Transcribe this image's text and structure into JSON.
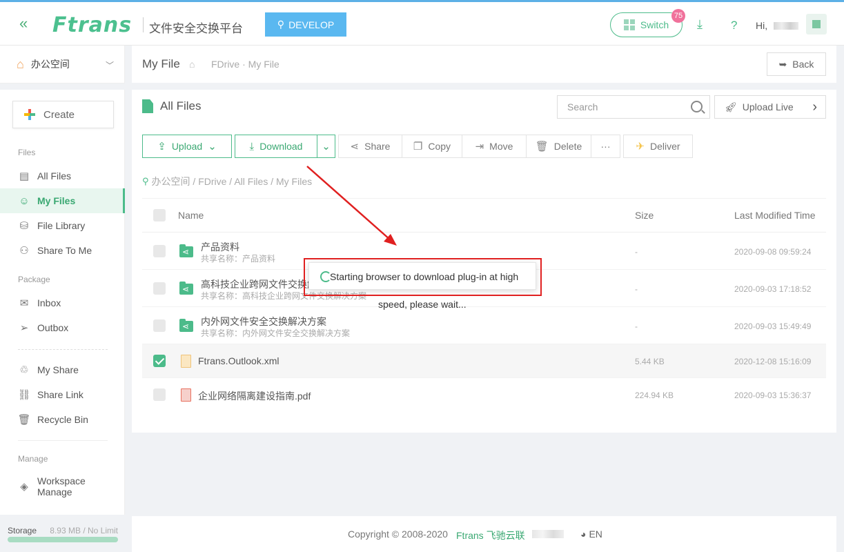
{
  "header": {
    "logo": "Ftrans",
    "subtitle": "文件安全交换平台",
    "env_label": "DEVELOP",
    "switch_label": "Switch",
    "switch_badge": "75",
    "help": "?",
    "greeting": "Hi,"
  },
  "sidebar": {
    "workspace": "办公空间",
    "create_label": "Create",
    "sections": {
      "files": "Files",
      "package": "Package",
      "manage": "Manage"
    },
    "items": {
      "all_files": "All Files",
      "my_files": "My Files",
      "file_library": "File Library",
      "share_to_me": "Share To Me",
      "inbox": "Inbox",
      "outbox": "Outbox",
      "my_share": "My Share",
      "share_link": "Share Link",
      "recycle_bin": "Recycle Bin",
      "workspace_manage_1": "Workspace",
      "workspace_manage_2": "Manage"
    },
    "storage_label": "Storage",
    "storage_value": "8.93 MB / No Limit"
  },
  "breadcrumb": {
    "title": "My File",
    "path": "FDrive · My File",
    "back": "Back"
  },
  "main": {
    "title": "All Files",
    "search_placeholder": "Search",
    "upload_live": "Upload Live",
    "toolbar": {
      "upload": "Upload",
      "download": "Download",
      "share": "Share",
      "copy": "Copy",
      "move": "Move",
      "delete": "Delete",
      "more": "···",
      "deliver": "Deliver"
    },
    "path": "办公空间 / FDrive / All Files / My Files",
    "columns": {
      "name": "Name",
      "size": "Size",
      "modified": "Last Modified Time"
    },
    "rows": [
      {
        "name": "产品资料",
        "sub": "共享名称：产品资料",
        "size": "-",
        "time": "2020-09-08 09:59:24"
      },
      {
        "name": "高科技企业跨网文件交换解决方案",
        "sub": "共享名称：高科技企业跨网文件交换解决方案",
        "size": "-",
        "time": "2020-09-03 17:18:52"
      },
      {
        "name": "内外网文件安全交换解决方案",
        "sub": "共享名称：内外网文件安全交换解决方案",
        "size": "-",
        "time": "2020-09-03 15:49:49"
      },
      {
        "name": "Ftrans.Outlook.xml",
        "size": "5.44 KB",
        "time": "2020-12-08 15:16:09"
      },
      {
        "name": "企业网络隔离建设指南.pdf",
        "size": "224.94 KB",
        "time": "2020-09-03 15:36:37"
      }
    ]
  },
  "toast": {
    "line1": "Starting browser to download plug-in at high",
    "line2": "speed, please wait..."
  },
  "footer": {
    "copyright": "Copyright © 2008-2020",
    "brand": "Ftrans 飞驰云联",
    "lang": "EN"
  },
  "colors": {
    "accent": "#4cbb8a",
    "env": "#5ab8f0",
    "badge": "#f0719b",
    "annotation": "#e02020"
  }
}
